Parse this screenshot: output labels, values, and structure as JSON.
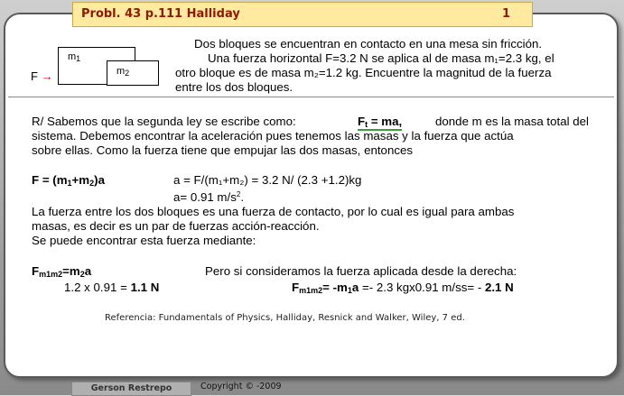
{
  "title": "Probl. 43  p.111 Halliday",
  "page_number": "1",
  "diagram": {
    "block1": "m",
    "block1_sub": "1",
    "block2": "m",
    "block2_sub": "2",
    "force": "F"
  },
  "problem": {
    "line1": "Dos bloques se encuentran en contacto en una mesa sin fricción.",
    "line2": "Una fuerza horizontal F=3.2 N se aplica al de masa m₁=2.3 kg, el",
    "line3": "otro bloque es de masa m₂=1.2 kg. Encuentre la magnitud de la fuerza",
    "line4": "entre los dos bloques."
  },
  "solution": {
    "intro_a": "R/ Sabemos que la segunda ley se escribe como:",
    "law_f": "F",
    "law_sub": "t",
    "law_rest": " = ma,",
    "intro_b": "donde m es la masa total del",
    "line2": "sistema. Debemos encontrar la aceleración pues tenemos las masas y la fuerza que actúa",
    "line3": "sobre ellas. Como la fuerza tiene que empujar las dos masas, entonces",
    "eq_f_a": "F = (m",
    "eq_f_s1": "1",
    "eq_f_b": "+m",
    "eq_f_s2": "2",
    "eq_f_c": ")a",
    "eq_a": "a = F/(m₁+m₂) = 3.2 N/ (2.3 +1.2)kg",
    "eq_a2_a": "a=  0.91 m/s",
    "eq_a2_sup": "2",
    "eq_a2_b": ".",
    "p2_line1": "La fuerza entre los dos bloques es una fuerza de contacto, por lo cual es igual para ambas",
    "p2_line2": "masas, es decir es un par de fuerzas acción-reacción.",
    "p2_line3": "Se puede encontrar esta fuerza mediante:",
    "left_f": "F",
    "left_f_sub": "m1m2",
    "left_f_rest_a": "=m",
    "left_f_rest_sub": "2",
    "left_f_rest_b": "a",
    "left_calc_a": "1.2 x 0.91 = ",
    "left_calc_b": "1.1 N",
    "right_intro": "Pero si consideramos la fuerza aplicada desde la derecha:",
    "right_f": "F",
    "right_f_sub": "m1m2",
    "right_f_rest_a": "= -m",
    "right_f_rest_sub": "1",
    "right_f_rest_b": "a",
    "right_calc": " =- 2.3 kgx0.91 m/ss= - ",
    "right_result": "2.1 N"
  },
  "reference": "Referencia: Fundamentals of Physics, Halliday, Resnick and Walker, Wiley, 7 ed.",
  "footer": {
    "author": "Gerson Restrepo",
    "copyright": "Copyright © -2009"
  },
  "colors": {
    "title_bg": "#ffeaa0",
    "title_text": "#8b1a00",
    "divider": "#4b9bd6",
    "arrow": "#d00000",
    "underline": "#3c9b3c"
  }
}
